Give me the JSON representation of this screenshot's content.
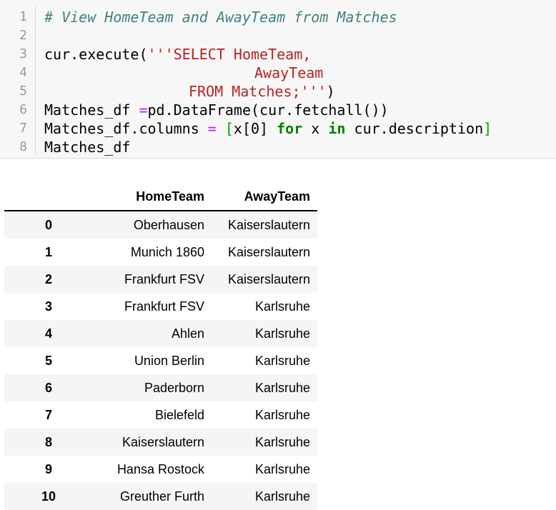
{
  "code_cell": {
    "line_numbers": [
      "1",
      "2",
      "3",
      "4",
      "5",
      "6",
      "7",
      "8"
    ],
    "line1": {
      "comment": "# View HomeTeam and AwayTeam from Matches"
    },
    "line3": {
      "code": "cur.execute(",
      "string": "'''SELECT HomeTeam,"
    },
    "line4": {
      "string": "AwayTeam"
    },
    "line5": {
      "string": "FROM Matches;'''",
      "code": ")"
    },
    "line6": {
      "code_a": "Matches_df ",
      "op": "=",
      "code_b": "pd.DataFrame(cur.fetchall())"
    },
    "line7": {
      "code_a": "Matches_df.columns ",
      "op": "=",
      "open_bracket": "[",
      "code_b": "x[0] ",
      "kw_for": "for",
      "code_c": " x ",
      "kw_in": "in",
      "code_d": " cur.description",
      "close_bracket": "]"
    },
    "line8": {
      "code": "Matches_df"
    }
  },
  "output_table": {
    "columns": [
      "",
      "HomeTeam",
      "AwayTeam"
    ],
    "rows": [
      {
        "index": "0",
        "home": "Oberhausen",
        "away": "Kaiserslautern"
      },
      {
        "index": "1",
        "home": "Munich 1860",
        "away": "Kaiserslautern"
      },
      {
        "index": "2",
        "home": "Frankfurt FSV",
        "away": "Kaiserslautern"
      },
      {
        "index": "3",
        "home": "Frankfurt FSV",
        "away": "Karlsruhe"
      },
      {
        "index": "4",
        "home": "Ahlen",
        "away": "Karlsruhe"
      },
      {
        "index": "5",
        "home": "Union Berlin",
        "away": "Karlsruhe"
      },
      {
        "index": "6",
        "home": "Paderborn",
        "away": "Karlsruhe"
      },
      {
        "index": "7",
        "home": "Bielefeld",
        "away": "Karlsruhe"
      },
      {
        "index": "8",
        "home": "Kaiserslautern",
        "away": "Karlsruhe"
      },
      {
        "index": "9",
        "home": "Hansa Rostock",
        "away": "Karlsruhe"
      },
      {
        "index": "10",
        "home": "Greuther Furth",
        "away": "Karlsruhe"
      }
    ]
  }
}
